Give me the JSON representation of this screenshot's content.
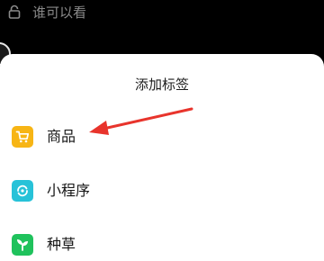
{
  "top": {
    "lock_icon": "lock-icon",
    "visibility_label": "谁可以看"
  },
  "sheet": {
    "title": "添加标签",
    "options": [
      {
        "label": "商品",
        "icon": "cart-icon",
        "color": "#f7b515"
      },
      {
        "label": "小程序",
        "icon": "mini-program-icon",
        "color": "#27c2d8"
      },
      {
        "label": "种草",
        "icon": "seedling-icon",
        "color": "#1fc25c"
      }
    ]
  },
  "annotation": {
    "arrow_color": "#e8342c"
  }
}
